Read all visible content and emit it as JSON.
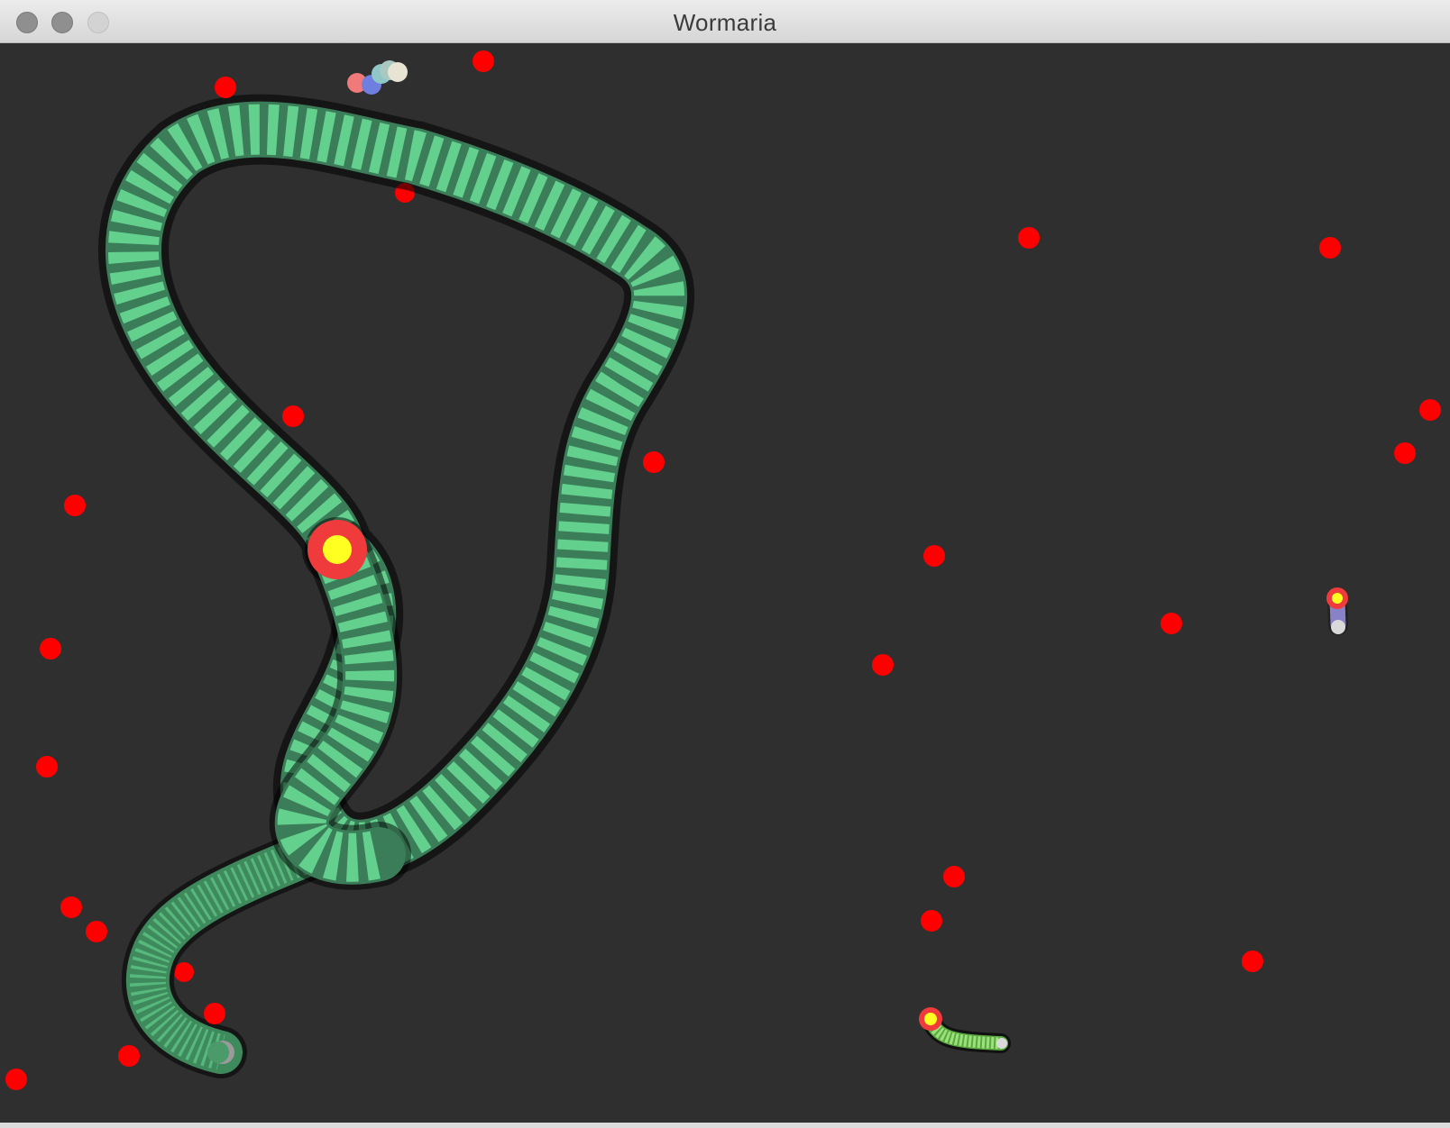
{
  "window": {
    "title": "Wormaria"
  },
  "colors": {
    "background": "#2f2f2f",
    "food": "#ff0000",
    "worm_light": "#63d08e",
    "worm_dark": "#3b7d58",
    "head_ring": "#ef3b3b",
    "head_center": "#ffff22",
    "purple_worm": "#8a82c8",
    "small_green_worm": "#86dc64"
  },
  "icons": {
    "close": "close-button-icon",
    "minimize": "minimize-button-icon",
    "maximize": "maximize-button-icon"
  }
}
